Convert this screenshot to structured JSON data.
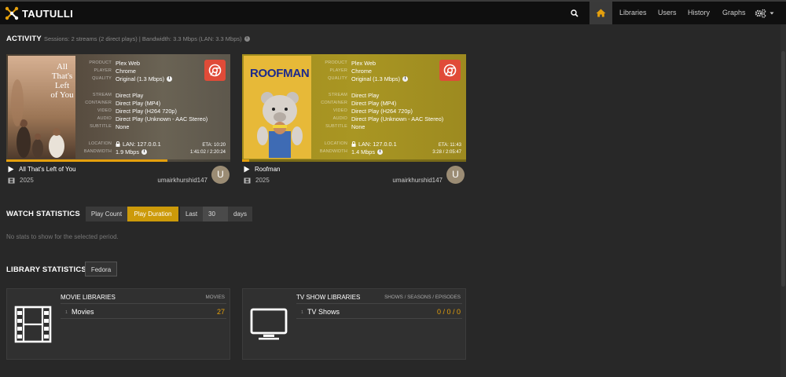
{
  "navbar": {
    "brand": "TAUTULLI",
    "links": [
      "Libraries",
      "Users",
      "History",
      "Graphs"
    ],
    "accent": "#e5a00d"
  },
  "activity": {
    "title": "ACTIVITY",
    "subtitle": "Sessions: 2 streams (2 direct plays) | Bandwidth: 3.3 Mbps (LAN: 3.3 Mbps)",
    "labels": {
      "product": "PRODUCT",
      "player": "PLAYER",
      "quality": "QUALITY",
      "stream": "STREAM",
      "container": "CONTAINER",
      "video": "VIDEO",
      "audio": "AUDIO",
      "subtitle": "SUBTITLE",
      "location": "LOCATION",
      "bandwidth": "BANDWIDTH"
    },
    "streams": [
      {
        "poster_title": "All That's Left of You",
        "product": "Plex Web",
        "player": "Chrome",
        "quality": "Original (1.3 Mbps)",
        "stream": "Direct Play",
        "container": "Direct Play (MP4)",
        "video": "Direct Play (H264 720p)",
        "audio": "Direct Play (Unknown - AAC Stereo)",
        "subtitle": "None",
        "location": "LAN: 127.0.0.1",
        "bandwidth": "1.9 Mbps",
        "eta": "ETA: 10:20",
        "time": "1:41:02 / 2:20:24",
        "progress_pct": 72,
        "title": "All That's Left of You",
        "year": "2025",
        "user": "umairkhurshid147",
        "avatar_letter": "U"
      },
      {
        "poster_title": "ROOFMAN",
        "product": "Plex Web",
        "player": "Chrome",
        "quality": "Original (1.3 Mbps)",
        "stream": "Direct Play",
        "container": "Direct Play (MP4)",
        "video": "Direct Play (H264 720p)",
        "audio": "Direct Play (Unknown - AAC Stereo)",
        "subtitle": "None",
        "location": "LAN: 127.0.0.1",
        "bandwidth": "1.4 Mbps",
        "eta": "ETA: 11:43",
        "time": "3:28 / 2:05:47",
        "progress_pct": 3,
        "title": "Roofman",
        "year": "2025",
        "user": "umairkhurshid147",
        "avatar_letter": "U"
      }
    ]
  },
  "watch_stats": {
    "title": "WATCH STATISTICS",
    "btn_play_count": "Play Count",
    "btn_play_duration": "Play Duration",
    "last_label": "Last",
    "days_value": "30",
    "days_label": "days",
    "empty": "No stats to show for the selected period."
  },
  "library_stats": {
    "title": "LIBRARY STATISTICS",
    "server": "Fedora",
    "panels": [
      {
        "heading": "MOVIE LIBRARIES",
        "right": "MOVIES",
        "idx": "1",
        "name": "Movies",
        "count": "27",
        "icon": "film-icon"
      },
      {
        "heading": "TV SHOW LIBRARIES",
        "right": "SHOWS / SEASONS / EPISODES",
        "idx": "1",
        "name": "TV Shows",
        "count": "0 / 0 / 0",
        "icon": "tv-icon"
      }
    ]
  }
}
